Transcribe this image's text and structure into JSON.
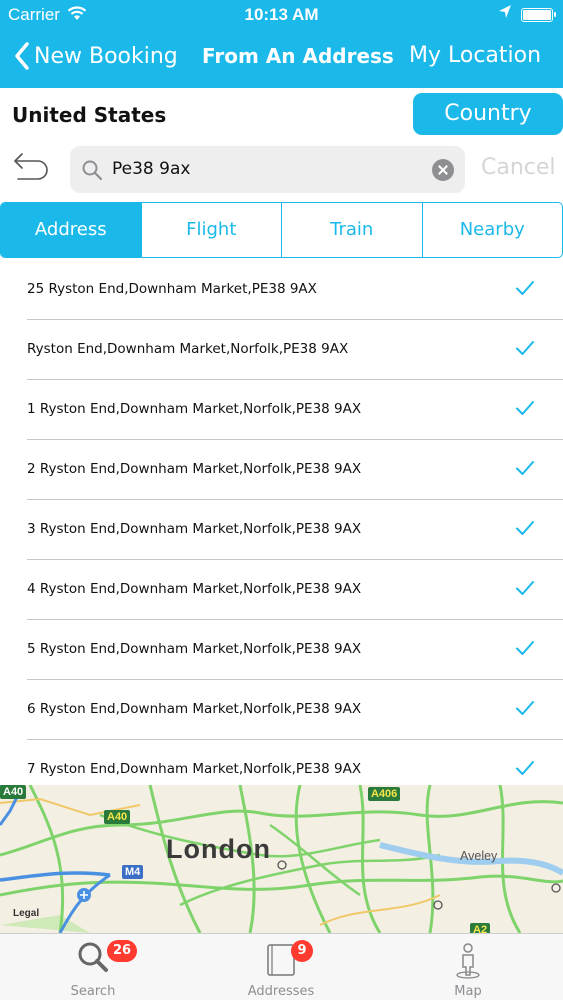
{
  "status_bar": {
    "carrier": "Carrier",
    "time": "10:13 AM"
  },
  "nav": {
    "back_label": "New Booking",
    "title": "From An Address",
    "right_label": "My Location"
  },
  "country": {
    "label": "United States",
    "button_label": "Country"
  },
  "search": {
    "value": "Pe38 9ax",
    "cancel_label": "Cancel"
  },
  "tabs": [
    {
      "label": "Address",
      "active": true
    },
    {
      "label": "Flight",
      "active": false
    },
    {
      "label": "Train",
      "active": false
    },
    {
      "label": "Nearby",
      "active": false
    }
  ],
  "results": [
    "25 Ryston End,Downham Market,PE38 9AX",
    "Ryston End,Downham Market,Norfolk,PE38 9AX",
    "1 Ryston End,Downham Market,Norfolk,PE38 9AX",
    "2 Ryston End,Downham Market,Norfolk,PE38 9AX",
    "3 Ryston End,Downham Market,Norfolk,PE38 9AX",
    "4 Ryston End,Downham Market,Norfolk,PE38 9AX",
    "5 Ryston End,Downham Market,Norfolk,PE38 9AX",
    "6 Ryston End,Downham Market,Norfolk,PE38 9AX",
    "7 Ryston End,Downham Market,Norfolk,PE38 9AX"
  ],
  "map": {
    "city_label": "London",
    "town_label": "Aveley",
    "legal_label": "Legal",
    "road_labels": [
      "A40",
      "A406",
      "M4",
      "A2"
    ]
  },
  "tab_bar": {
    "items": [
      {
        "label": "Search",
        "badge": "26",
        "icon": "search-icon"
      },
      {
        "label": "Addresses",
        "badge": "9",
        "icon": "address-book-icon"
      },
      {
        "label": "Map",
        "badge": "",
        "icon": "map-pin-person-icon"
      }
    ]
  },
  "colors": {
    "accent": "#1bb9ea",
    "badge": "#ff3b30",
    "cancel_disabled": "#d5d5d7"
  }
}
